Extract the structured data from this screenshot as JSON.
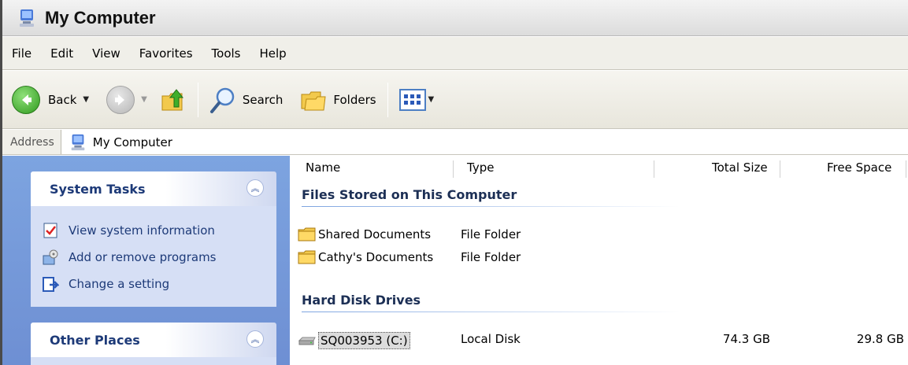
{
  "window": {
    "title": "My Computer"
  },
  "menu": [
    "File",
    "Edit",
    "View",
    "Favorites",
    "Tools",
    "Help"
  ],
  "toolbar": {
    "back_label": "Back",
    "search_label": "Search",
    "folders_label": "Folders"
  },
  "address": {
    "label": "Address",
    "value": "My Computer"
  },
  "system_tasks": {
    "title": "System Tasks",
    "items": [
      "View system information",
      "Add or remove programs",
      "Change a setting"
    ]
  },
  "other_places": {
    "title": "Other Places"
  },
  "columns": {
    "name": "Name",
    "type": "Type",
    "total_size": "Total Size",
    "free_space": "Free Space"
  },
  "groups": {
    "files_stored": {
      "title": "Files Stored on This Computer",
      "items": [
        {
          "name": "Shared Documents",
          "type": "File Folder"
        },
        {
          "name": "Cathy's Documents",
          "type": "File Folder"
        }
      ]
    },
    "hard_disks": {
      "title": "Hard Disk Drives",
      "items": [
        {
          "name": "SQ003953 (C:)",
          "type": "Local Disk",
          "total_size": "74.3 GB",
          "free_space": "29.8 GB"
        }
      ]
    }
  },
  "colors": {
    "task_pane_bg": "#7da4e0",
    "task_header_text": "#1d3a78",
    "task_body_bg": "#d6dff5"
  },
  "icons": [
    "computer-icon",
    "back-arrow-icon",
    "forward-arrow-icon",
    "up-folder-icon",
    "search-magnifier-icon",
    "folders-icon",
    "views-icon",
    "folder-icon",
    "hard-drive-icon",
    "system-info-icon",
    "add-remove-programs-icon",
    "change-setting-icon",
    "collapse-chevron-icon"
  ]
}
